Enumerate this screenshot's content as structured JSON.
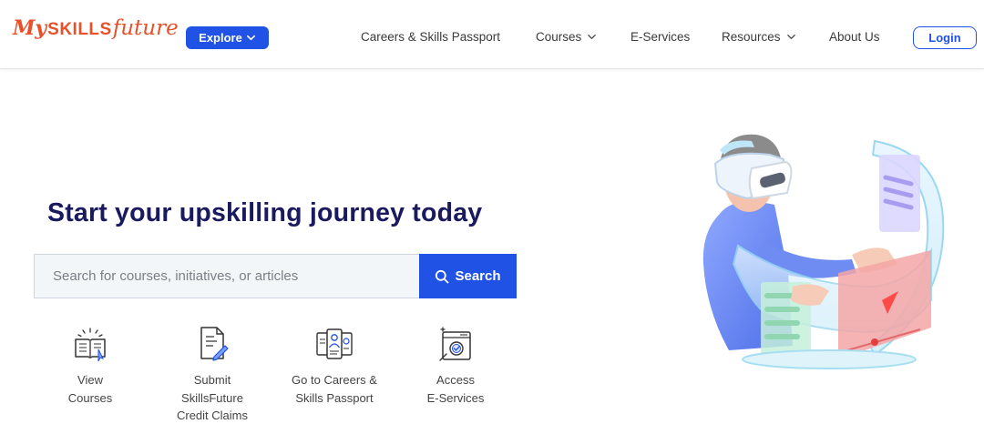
{
  "header": {
    "logo": {
      "my": "My",
      "skills": "SKILLS",
      "future": "future"
    },
    "explore_label": "Explore",
    "nav": {
      "careers": "Careers & Skills Passport",
      "courses": "Courses",
      "eservices": "E-Services",
      "resources": "Resources",
      "about": "About Us"
    },
    "login_label": "Login"
  },
  "hero": {
    "title": "Start your upskilling journey today",
    "search": {
      "placeholder": "Search for courses, initiatives, or articles",
      "value": "",
      "button_label": "Search"
    }
  },
  "quick_links": [
    {
      "icon": "book-icon",
      "line1": "View",
      "line2": "Courses",
      "line3": ""
    },
    {
      "icon": "document-pen-icon",
      "line1": "Submit",
      "line2": "SkillsFuture",
      "line3": "Credit Claims"
    },
    {
      "icon": "passport-icon",
      "line1": "Go to Careers &",
      "line2": "Skills Passport",
      "line3": ""
    },
    {
      "icon": "browser-check-icon",
      "line1": "Access",
      "line2": "E-Services",
      "line3": ""
    }
  ],
  "colors": {
    "brand": "#e8502a",
    "primary": "#2152e6",
    "title": "#1a1a5e"
  }
}
